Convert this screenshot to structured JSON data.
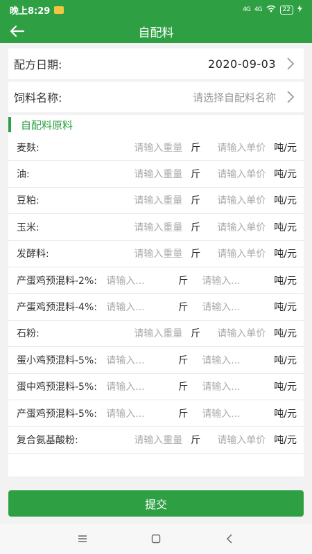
{
  "status_bar": {
    "time": "晚上8:29",
    "signal1": "4G",
    "signal2": "4G",
    "battery": "22"
  },
  "header": {
    "title": "自配料"
  },
  "form": {
    "date_label": "配方日期:",
    "date_value": "2020-09-03",
    "feed_label": "饲料名称:",
    "feed_placeholder": "请选择自配料名称"
  },
  "section": {
    "title": "自配料原料"
  },
  "ingredients": [
    {
      "name": "麦麸:",
      "weight_ph": "请输入重量",
      "weight_unit": "斤",
      "price_ph": "请输入单价",
      "price_unit": "吨/元"
    },
    {
      "name": "油:",
      "weight_ph": "请输入重量",
      "weight_unit": "斤",
      "price_ph": "请输入单价",
      "price_unit": "吨/元"
    },
    {
      "name": "豆粕:",
      "weight_ph": "请输入重量",
      "weight_unit": "斤",
      "price_ph": "请输入单价",
      "price_unit": "吨/元"
    },
    {
      "name": "玉米:",
      "weight_ph": "请输入重量",
      "weight_unit": "斤",
      "price_ph": "请输入单价",
      "price_unit": "吨/元"
    },
    {
      "name": "发酵料:",
      "weight_ph": "请输入重量",
      "weight_unit": "斤",
      "price_ph": "请输入单价",
      "price_unit": "吨/元"
    },
    {
      "name": "产蛋鸡预混料-2%:",
      "weight_ph": "请输入...",
      "weight_unit": "斤",
      "price_ph": "请输入...",
      "price_unit": "吨/元"
    },
    {
      "name": "产蛋鸡预混料-4%:",
      "weight_ph": "请输入...",
      "weight_unit": "斤",
      "price_ph": "请输入...",
      "price_unit": "吨/元"
    },
    {
      "name": "石粉:",
      "weight_ph": "请输入重量",
      "weight_unit": "斤",
      "price_ph": "请输入单价",
      "price_unit": "吨/元"
    },
    {
      "name": "蛋小鸡预混料-5%:",
      "weight_ph": "请输入...",
      "weight_unit": "斤",
      "price_ph": "请输入...",
      "price_unit": "吨/元"
    },
    {
      "name": "蛋中鸡预混料-5%:",
      "weight_ph": "请输入...",
      "weight_unit": "斤",
      "price_ph": "请输入...",
      "price_unit": "吨/元"
    },
    {
      "name": "产蛋鸡预混料-5%:",
      "weight_ph": "请输入...",
      "weight_unit": "斤",
      "price_ph": "请输入...",
      "price_unit": "吨/元"
    },
    {
      "name": "复合氨基酸粉:",
      "weight_ph": "请输入重量",
      "weight_unit": "斤",
      "price_ph": "请输入单价",
      "price_unit": "吨/元"
    }
  ],
  "submit_label": "提交",
  "colors": {
    "accent": "#2ea043",
    "placeholder": "#999999"
  }
}
